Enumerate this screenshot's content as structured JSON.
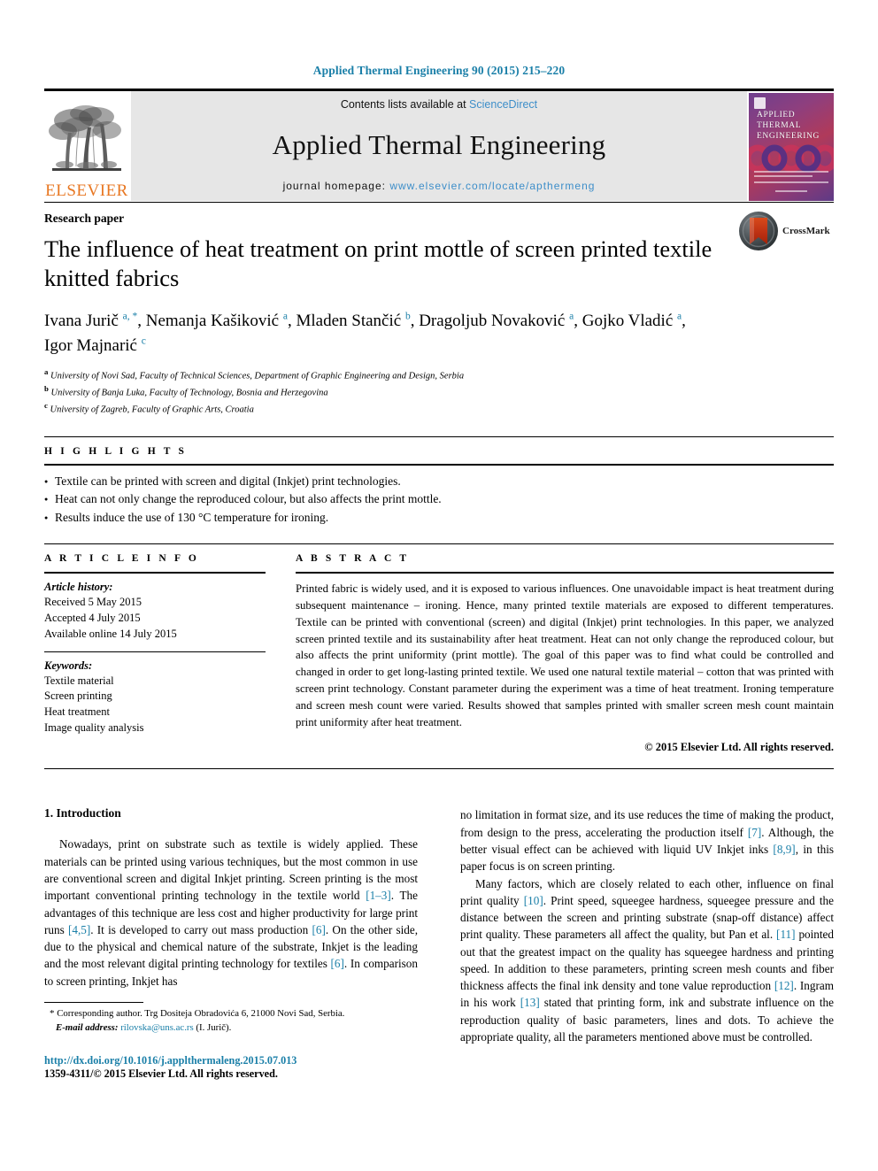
{
  "running_head": "Applied Thermal Engineering 90 (2015) 215–220",
  "masthead": {
    "contents_prefix": "Contents lists available at",
    "sciencedirect": "ScienceDirect",
    "journal_name": "Applied Thermal Engineering",
    "homepage_label": "journal homepage:",
    "homepage_url": "www.elsevier.com/locate/apthermeng",
    "elsevier_wordmark": "ELSEVIER",
    "cover_title_lines": [
      "APPLIED",
      "THERMAL",
      "ENGINEERING"
    ],
    "accent_link_color": "#3d8ec9",
    "elsevier_orange": "#E87722"
  },
  "article": {
    "paper_type": "Research paper",
    "title": "The influence of heat treatment on print mottle of screen printed textile knitted fabrics",
    "authors_html": "Ivana Jurič <sup>a, *</sup>, Nemanja Kašiković <sup>a</sup>, Mladen Stančić <sup>b</sup>, Dragoljub Novaković <sup>a</sup>, Gojko Vladić <sup>a</sup>, Igor Majnarić <sup>c</sup>",
    "affiliations": [
      {
        "marker": "a",
        "text": "University of Novi Sad, Faculty of Technical Sciences, Department of Graphic Engineering and Design, Serbia"
      },
      {
        "marker": "b",
        "text": "University of Banja Luka, Faculty of Technology, Bosnia and Herzegovina"
      },
      {
        "marker": "c",
        "text": "University of Zagreb, Faculty of Graphic Arts, Croatia"
      }
    ],
    "crossmark_label": "CrossMark"
  },
  "highlights": {
    "heading": "H I G H L I G H T S",
    "items": [
      "Textile can be printed with screen and digital (Inkjet) print technologies.",
      "Heat can not only change the reproduced colour, but also affects the print mottle.",
      "Results induce the use of 130 °C temperature for ironing."
    ]
  },
  "article_info": {
    "heading": "A R T I C L E   I N F O",
    "history_label": "Article history:",
    "history": [
      "Received 5 May 2015",
      "Accepted 4 July 2015",
      "Available online 14 July 2015"
    ],
    "keywords_label": "Keywords:",
    "keywords": [
      "Textile material",
      "Screen printing",
      "Heat treatment",
      "Image quality analysis"
    ]
  },
  "abstract": {
    "heading": "A B S T R A C T",
    "text": "Printed fabric is widely used, and it is exposed to various influences. One unavoidable impact is heat treatment during subsequent maintenance – ironing. Hence, many printed textile materials are exposed to different temperatures. Textile can be printed with conventional (screen) and digital (Inkjet) print technologies. In this paper, we analyzed screen printed textile and its sustainability after heat treatment. Heat can not only change the reproduced colour, but also affects the print uniformity (print mottle). The goal of this paper was to find what could be controlled and changed in order to get long-lasting printed textile. We used one natural textile material – cotton that was printed with screen print technology. Constant parameter during the experiment was a time of heat treatment. Ironing temperature and screen mesh count were varied. Results showed that samples printed with smaller screen mesh count maintain print uniformity after heat treatment.",
    "copyright": "© 2015 Elsevier Ltd. All rights reserved."
  },
  "introduction": {
    "section_number_title": "1.  Introduction",
    "left_paragraphs_html": [
      "Nowadays, print on substrate such as textile is widely applied. These materials can be printed using various techniques, but the most common in use are conventional screen and digital Inkjet printing. Screen printing is the most important conventional printing technology in the textile world <span class=\"ref\">[1–3]</span>. The advantages of this technique are less cost and higher productivity for large print runs <span class=\"ref\">[4,5]</span>. It is developed to carry out mass production <span class=\"ref\">[6]</span>. On the other side, due to the physical and chemical nature of the substrate, Inkjet is the leading and the most relevant digital printing technology for textiles <span class=\"ref\">[6]</span>. In comparison to screen printing, Inkjet has"
    ],
    "right_paragraphs_html": [
      "no limitation in format size, and its use reduces the time of making the product, from design to the press, accelerating the production itself <span class=\"ref\">[7]</span>. Although, the better visual effect can be achieved with liquid UV Inkjet inks <span class=\"ref\">[8,9]</span>, in this paper focus is on screen printing.",
      "Many factors, which are closely related to each other, influence on final print quality <span class=\"ref\">[10]</span>. Print speed, squeegee hardness, squeegee pressure and the distance between the screen and printing substrate (snap-off distance) affect print quality. These parameters all affect the quality, but Pan et al. <span class=\"ref\">[11]</span> pointed out that the greatest impact on the quality has squeegee hardness and printing speed. In addition to these parameters, printing screen mesh counts and fiber thickness affects the final ink density and tone value reproduction <span class=\"ref\">[12]</span>. Ingram in his work <span class=\"ref\">[13]</span> stated that printing form, ink and substrate influence on the reproduction quality of basic parameters, lines and dots. To achieve the appropriate quality, all the parameters mentioned above must be controlled."
    ]
  },
  "footnotes": {
    "corresponding_star": "*",
    "corresponding_text": "Corresponding author. Trg Dositeja Obradovića 6, 21000 Novi Sad, Serbia.",
    "email_label": "E-mail address:",
    "email": "rilovska@uns.ac.rs",
    "email_owner": "(I. Jurič)."
  },
  "footer": {
    "doi": "http://dx.doi.org/10.1016/j.applthermaleng.2015.07.013",
    "issn_line": "1359-4311/© 2015 Elsevier Ltd. All rights reserved."
  }
}
